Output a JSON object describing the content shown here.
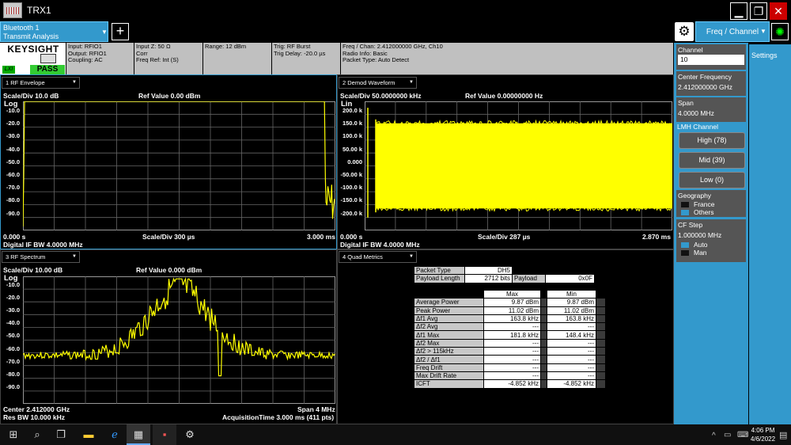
{
  "window": {
    "title": "TRX1"
  },
  "tabs": {
    "tab1_line1": "Bluetooth 1",
    "tab1_line2": "Transmit Analysis",
    "add": "+"
  },
  "menu": {
    "freq_channel": "Freq / Channel"
  },
  "info": {
    "logo": "KEYSIGHT",
    "lxi": "LXI",
    "pass": "PASS",
    "c1": [
      "Input: RFIO1",
      "Output: RFIO1",
      "Coupling: AC"
    ],
    "c2": [
      "Input Z: 50 Ω",
      "Corr",
      "Freq Ref: Int (S)"
    ],
    "c3": [
      "Range: 12 dBm"
    ],
    "c4": [
      "Trig: RF Burst",
      "Trig Delay: -20.0 µs"
    ],
    "c5": [
      "Freq / Chan: 2.412000000 GHz,  Ch10",
      "Radio Info: Basic",
      "Packet Type: Auto Detect"
    ]
  },
  "w1": {
    "dd": "1 RF Envelope",
    "scale": "Scale/Div 10.0 dB",
    "ref": "Ref Value 0.00 dBm",
    "mode": "Log",
    "ticks": [
      "-10.0",
      "-20.0",
      "-30.0",
      "-40.0",
      "-50.0",
      "-60.0",
      "-70.0",
      "-80.0",
      "-90.0"
    ],
    "start": "0.000 s",
    "xscale": "Scale/Div 300 µs",
    "stop": "3.000 ms",
    "ifbw": "Digital IF BW 4.0000 MHz"
  },
  "w2": {
    "dd": "2 Demod Waveform",
    "scale": "Scale/Div 50.0000000 kHz",
    "ref": "Ref Value 0.00000000 Hz",
    "mode": "Lin",
    "ticks": [
      "200.0 k",
      "150.0 k",
      "100.0 k",
      "50.00 k",
      "0.000",
      "-50.00 k",
      "-100.0 k",
      "-150.0 k",
      "-200.0 k"
    ],
    "start": "0.000 s",
    "xscale": "Scale/Div 287 µs",
    "stop": "2.870 ms",
    "ifbw": "Digital IF BW 4.0000 MHz"
  },
  "w3": {
    "dd": "3 RF Spectrum",
    "scale": "Scale/Div 10.00 dB",
    "ref": "Ref Value 0.000 dBm",
    "mode": "Log",
    "ticks": [
      "-10.0",
      "-20.0",
      "-30.0",
      "-40.0",
      "-50.0",
      "-60.0",
      "-70.0",
      "-80.0",
      "-90.0"
    ],
    "center": "Center 2.412000 GHz",
    "span": "Span 4 MHz",
    "rbw": "Res BW 10.000 kHz",
    "acq": "AcquisitionTime 3.000 ms (411 pts)"
  },
  "w4": {
    "dd": "4 Quad Metrics",
    "packet_type_label": "Packet Type",
    "packet_type": "DH5",
    "payload_len_label": "Payload Length",
    "payload_len": "2712 bits",
    "payload_label": "Payload",
    "payload": "0x0F",
    "col_max": "Max",
    "col_min": "Min",
    "rows": [
      [
        "Average Power",
        "9.87 dBm",
        "9.87 dBm"
      ],
      [
        "Peak Power",
        "11.02 dBm",
        "11.02 dBm"
      ],
      [
        "Δf1 Avg",
        "163.8 kHz",
        "163.8 kHz"
      ],
      [
        "Δf2 Avg",
        "---",
        "---"
      ],
      [
        "Δf1 Max",
        "181.8 kHz",
        "148.4 kHz"
      ],
      [
        "Δf2 Max",
        "---",
        "---"
      ],
      [
        "Δf2 > 115kHz",
        "---",
        "---"
      ],
      [
        "Δf2 / Δf1",
        "---",
        "---"
      ],
      [
        "Freq Drift",
        "---",
        "---"
      ],
      [
        "Max Drift Rate",
        "---",
        "---"
      ],
      [
        "ICFT",
        "-4.852 kHz",
        "-4.852 kHz"
      ]
    ]
  },
  "right": {
    "settings": "Settings",
    "channel_label": "Channel",
    "channel_value": "10",
    "cf_label": "Center Frequency",
    "cf_value": "2.412000000 GHz",
    "span_label": "Span",
    "span_value": "4.0000 MHz",
    "lmh_label": "LMH Channel",
    "high": "High (78)",
    "mid": "Mid (39)",
    "low": "Low (0)",
    "geo_label": "Geography",
    "geo_opt1": "France",
    "geo_opt2": "Others",
    "cfstep_label": "CF Step",
    "cfstep_value": "1.000000 MHz",
    "cfstep_opt1": "Auto",
    "cfstep_opt2": "Man"
  },
  "taskbar": {
    "time": "4:06 PM",
    "date": "4/6/2022"
  },
  "colors": {
    "trace": "#ffff00",
    "accent": "#3399cc",
    "pass": "#33cc33"
  }
}
